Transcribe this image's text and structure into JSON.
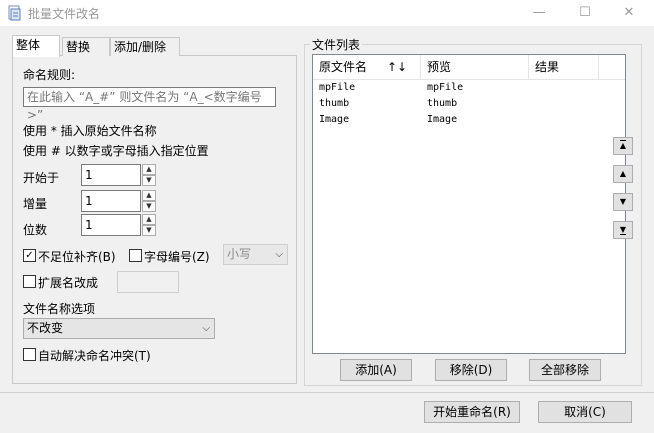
{
  "window": {
    "title": "批量文件改名",
    "minimize": "—",
    "maximize": "☐",
    "close": "✕"
  },
  "tabs": [
    {
      "label": "整体"
    },
    {
      "label": "替换"
    },
    {
      "label": "添加/删除"
    }
  ],
  "naming": {
    "rule_label": "命名规则:",
    "rule_placeholder": "在此输入 “A_#” 则文件名为 “A_<数字编号>”",
    "hint1": "使用 * 插入原始文件名称",
    "hint2": "使用 # 以数字或字母插入指定位置",
    "start_label": "开始于",
    "start_value": "1",
    "step_label": "增量",
    "step_value": "1",
    "digits_label": "位数",
    "digits_value": "1",
    "pad_label": "不足位补齐(B)",
    "pad_checked": "✓",
    "alpha_label": "字母编号(Z)",
    "case_value": "小写",
    "ext_label": "扩展名改成",
    "name_option_label": "文件名称选项",
    "name_option_value": "不改变",
    "auto_resolve_label": "自动解决命名冲突(T)"
  },
  "filelist": {
    "group_title": "文件列表",
    "columns": {
      "original": "原文件名",
      "sort": "↑↓",
      "preview": "预览",
      "result": "结果"
    },
    "rows": [
      {
        "original": "mpFile",
        "preview": "mpFile",
        "result": ""
      },
      {
        "original": "thumb",
        "preview": "thumb",
        "result": ""
      },
      {
        "original": "Image",
        "preview": "Image",
        "result": ""
      }
    ],
    "add_label": "添加(A)",
    "remove_label": "移除(D)",
    "remove_all_label": "全部移除"
  },
  "side_buttons": {
    "top": "▲",
    "up": "▲",
    "down": "▼",
    "bottom": "▼"
  },
  "footer": {
    "start_label": "开始重命名(R)",
    "cancel_label": "取消(C)"
  }
}
